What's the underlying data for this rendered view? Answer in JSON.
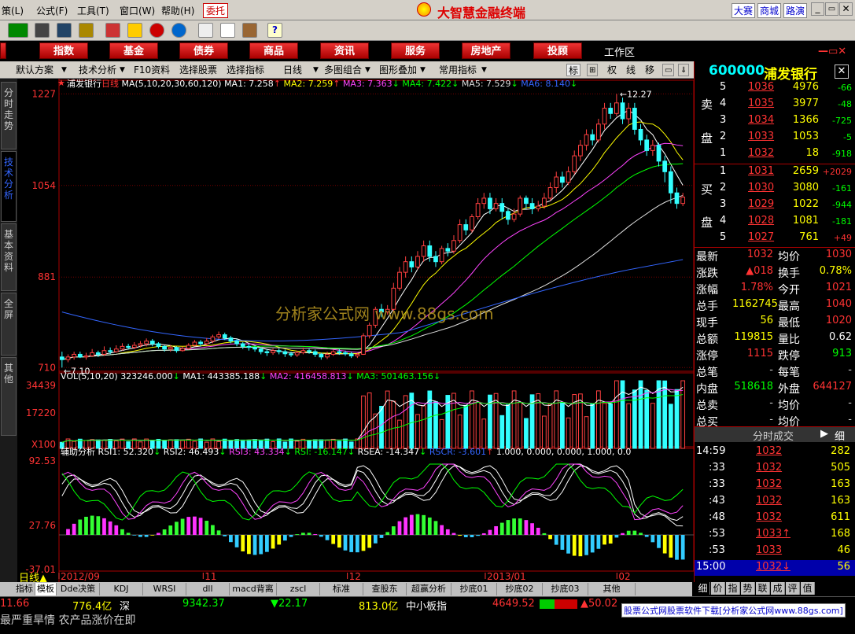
{
  "menu": {
    "items": [
      "策(L)",
      "公式(F)",
      "工具(T)",
      "窗口(W)",
      "帮助(H)"
    ],
    "weituo": "委托",
    "app_title": "大智慧金融终端",
    "links": [
      "大赛",
      "商城",
      "路演"
    ]
  },
  "categories": [
    "",
    "指数",
    "基金",
    "债券",
    "商品",
    "资讯",
    "服务",
    "房地产",
    "投顾"
  ],
  "workspace": "工作区",
  "subtoolbar": {
    "items": [
      "默认方案",
      "技术分析",
      "F10资料",
      "选择股票",
      "选择指标",
      "日线",
      "多图组合",
      "图形叠加",
      "常用指标"
    ],
    "right": [
      "标",
      "",
      "权",
      "线",
      "移"
    ]
  },
  "left_tabs": [
    "分时走势",
    "技术分析",
    "基本资料",
    "全屏",
    "其他"
  ],
  "main_legend": {
    "stock": "浦发银行",
    "period": "日线",
    "ma": "MA(5,10,20,30,60,120)",
    "items": [
      {
        "t": "MA1: 7.258",
        "c": "#ffffff"
      },
      {
        "t": "MA2: 7.259",
        "c": "#ffff00"
      },
      {
        "t": "MA3: 7.363",
        "c": "#ff44ff"
      },
      {
        "t": "MA4: 7.422",
        "c": "#00ff00"
      },
      {
        "t": "MA5: 7.529",
        "c": "#dddddd"
      },
      {
        "t": "MA6: 8.140",
        "c": "#3366ff"
      }
    ],
    "arrows": [
      "↑",
      "↑",
      "↓",
      "↓",
      "↓",
      "↓"
    ]
  },
  "y_main": [
    "1227",
    "1054",
    "881",
    "710"
  ],
  "annot": {
    "high": "12.27",
    "low": "7.10"
  },
  "watermark": "分析家公式网 www.88gs.com",
  "vol_legend": {
    "prefix": "VOL(5,10,20)",
    "items": [
      {
        "t": "323246.000",
        "c": "#ffffff"
      },
      {
        "t": "MA1: 443385.188",
        "c": "#ffffff"
      },
      {
        "t": "MA2: 416458.813",
        "c": "#ff44ff"
      },
      {
        "t": "MA3: 501463.156",
        "c": "#00ff00"
      }
    ],
    "arrows": [
      "↓",
      "↓",
      "↓",
      "↓"
    ]
  },
  "y_vol": [
    "34439",
    "17220",
    "X100"
  ],
  "rsi_legend": {
    "prefix": "辅助分析",
    "items": [
      {
        "t": "RSI1: 52.320",
        "c": "#ffffff"
      },
      {
        "t": "RSI2: 46.493",
        "c": "#ffffff"
      },
      {
        "t": "RSI3: 43.334",
        "c": "#ff44ff"
      },
      {
        "t": "RSI: -16.147",
        "c": "#00ff00"
      },
      {
        "t": "RSEA: -14.347",
        "c": "#ffffff"
      },
      {
        "t": "RSCR: -3.601",
        "c": "#3366ff"
      },
      {
        "t": "1.000, 0.000, 0.000, 1.000, 0.0",
        "c": "#ffffff"
      }
    ],
    "arrows": [
      "↓",
      "↓",
      "↓",
      "↓",
      "↓",
      "↑",
      ""
    ]
  },
  "y_rsi": [
    "92.53",
    "27.76",
    "-37.01"
  ],
  "x_dates": [
    "2012/09",
    "11",
    "12",
    "2013/01",
    "02"
  ],
  "period_label": "日线",
  "bottom_tabs": [
    "指标",
    "模板",
    "Dde决策",
    "KDJ",
    "WRSI",
    "dll",
    "macd背离",
    "zscl",
    "标准",
    "查股东",
    "超赢分析",
    "抄底01",
    "抄底02",
    "抄底03",
    "其他"
  ],
  "quote": {
    "code": "600000",
    "name": "浦发银行",
    "sell": [
      {
        "n": "5",
        "p": "1036",
        "v": "4976",
        "c": "-66"
      },
      {
        "n": "4",
        "p": "1035",
        "v": "3977",
        "c": "-48"
      },
      {
        "n": "3",
        "p": "1034",
        "v": "1366",
        "c": "-725"
      },
      {
        "n": "2",
        "p": "1033",
        "v": "1053",
        "c": "-5"
      },
      {
        "n": "1",
        "p": "1032",
        "v": "18",
        "c": "-918"
      }
    ],
    "buy": [
      {
        "n": "1",
        "p": "1031",
        "v": "2659",
        "c": "+2029"
      },
      {
        "n": "2",
        "p": "1030",
        "v": "3080",
        "c": "-161"
      },
      {
        "n": "3",
        "p": "1029",
        "v": "1022",
        "c": "-944"
      },
      {
        "n": "4",
        "p": "1028",
        "v": "1081",
        "c": "-181"
      },
      {
        "n": "5",
        "p": "1027",
        "v": "761",
        "c": "+49"
      }
    ],
    "sell_label": [
      "卖",
      "盘"
    ],
    "buy_label": [
      "买",
      "盘"
    ],
    "stats": [
      {
        "l1": "最新",
        "v1": "1032",
        "c1": "#ff3333",
        "l2": "均价",
        "v2": "1030",
        "c2": "#ff3333"
      },
      {
        "l1": "涨跌",
        "v1": "▲018",
        "c1": "#ff3333",
        "l2": "换手",
        "v2": "0.78%",
        "c2": "#ffff00"
      },
      {
        "l1": "涨幅",
        "v1": "1.78%",
        "c1": "#ff3333",
        "l2": "今开",
        "v2": "1021",
        "c2": "#ff3333"
      },
      {
        "l1": "总手",
        "v1": "1162745",
        "c1": "#ffff00",
        "l2": "最高",
        "v2": "1040",
        "c2": "#ff3333"
      },
      {
        "l1": "现手",
        "v1": "56",
        "c1": "#ffff00",
        "l2": "最低",
        "v2": "1020",
        "c2": "#ff3333"
      },
      {
        "l1": "总额",
        "v1": "119815",
        "c1": "#ffff00",
        "l2": "量比",
        "v2": "0.62",
        "c2": "#ffffff"
      },
      {
        "l1": "涨停",
        "v1": "1115",
        "c1": "#ff3333",
        "l2": "跌停",
        "v2": "913",
        "c2": "#00ff00"
      },
      {
        "l1": "总笔",
        "v1": "-",
        "c1": "#cccccc",
        "l2": "每笔",
        "v2": "-",
        "c2": "#cccccc"
      },
      {
        "l1": "内盘",
        "v1": "518618",
        "c1": "#00ff00",
        "l2": "外盘",
        "v2": "644127",
        "c2": "#ff3333"
      },
      {
        "l1": "总卖",
        "v1": "-",
        "c1": "#cccccc",
        "l2": "均价",
        "v2": "-",
        "c2": "#cccccc"
      },
      {
        "l1": "总买",
        "v1": "-",
        "c1": "#cccccc",
        "l2": "均价",
        "v2": "-",
        "c2": "#cccccc"
      }
    ],
    "ticks_header": "分时成交",
    "ticks_btn": "细",
    "ticks": [
      {
        "t": "14:59",
        "p": "1032",
        "v": "282"
      },
      {
        "t": ":33",
        "p": "1032",
        "v": "505"
      },
      {
        "t": ":33",
        "p": "1032",
        "v": "163"
      },
      {
        "t": ":43",
        "p": "1032",
        "v": "163"
      },
      {
        "t": ":48",
        "p": "1032",
        "v": "611"
      },
      {
        "t": ":53",
        "p": "1033↑",
        "v": "168"
      },
      {
        "t": ":53",
        "p": "1033",
        "v": "46"
      },
      {
        "t": "15:00",
        "p": "1032↓",
        "v": "56"
      }
    ],
    "rtabs": [
      "细",
      "价",
      "指",
      "势",
      "联",
      "成",
      "评",
      "值"
    ]
  },
  "status": {
    "a": "11.66",
    "b": "776.4亿",
    "c": "深",
    "d": "9342.37",
    "e": "▼22.17",
    "f": "813.0亿",
    "g": "中小板指",
    "h": "4649.52",
    "i": "▲50.02",
    "j": "",
    "k": "股票公式网股票软件下载[分析家公式网www.88gs.com]"
  },
  "ticker": "最严重旱情 农产品涨价在即",
  "chart_data": {
    "type": "candlestick",
    "series": "浦发银行 日线",
    "high": 12.27,
    "low": 7.1,
    "y_ticks": [
      12.27,
      10.54,
      8.81,
      7.1
    ],
    "candles": [
      [
        7.3,
        7.25,
        7.4,
        7.1
      ],
      [
        7.25,
        7.3,
        7.35,
        7.2
      ],
      [
        7.3,
        7.35,
        7.4,
        7.25
      ],
      [
        7.35,
        7.3,
        7.4,
        7.28
      ],
      [
        7.3,
        7.32,
        7.38,
        7.25
      ],
      [
        7.32,
        7.38,
        7.45,
        7.3
      ],
      [
        7.38,
        7.35,
        7.42,
        7.3
      ],
      [
        7.35,
        7.42,
        7.5,
        7.32
      ],
      [
        7.42,
        7.4,
        7.48,
        7.35
      ],
      [
        7.4,
        7.45,
        7.52,
        7.38
      ],
      [
        7.45,
        7.5,
        7.56,
        7.42
      ],
      [
        7.5,
        7.48,
        7.55,
        7.44
      ],
      [
        7.48,
        7.52,
        7.58,
        7.45
      ],
      [
        7.52,
        7.55,
        7.6,
        7.48
      ],
      [
        7.55,
        7.6,
        7.65,
        7.5
      ],
      [
        7.6,
        7.55,
        7.64,
        7.5
      ],
      [
        7.55,
        7.5,
        7.58,
        7.46
      ],
      [
        7.5,
        7.45,
        7.52,
        7.4
      ],
      [
        7.45,
        7.48,
        7.52,
        7.4
      ],
      [
        7.48,
        7.42,
        7.5,
        7.38
      ],
      [
        7.42,
        7.46,
        7.5,
        7.4
      ],
      [
        7.46,
        7.52,
        7.56,
        7.44
      ],
      [
        7.52,
        7.58,
        7.62,
        7.5
      ],
      [
        7.58,
        7.55,
        7.62,
        7.5
      ],
      [
        7.55,
        7.6,
        7.66,
        7.52
      ],
      [
        7.6,
        7.68,
        7.72,
        7.56
      ],
      [
        7.68,
        7.72,
        7.78,
        7.64
      ],
      [
        7.72,
        7.66,
        7.76,
        7.62
      ],
      [
        7.66,
        7.6,
        7.7,
        7.56
      ],
      [
        7.6,
        7.55,
        7.64,
        7.5
      ],
      [
        7.55,
        7.5,
        7.58,
        7.45
      ],
      [
        7.5,
        7.48,
        7.55,
        7.42
      ],
      [
        7.48,
        7.45,
        7.5,
        7.4
      ],
      [
        7.45,
        7.4,
        7.48,
        7.35
      ],
      [
        7.4,
        7.38,
        7.45,
        7.32
      ],
      [
        7.38,
        7.42,
        7.46,
        7.34
      ],
      [
        7.42,
        7.4,
        7.46,
        7.35
      ],
      [
        7.4,
        7.36,
        7.44,
        7.3
      ],
      [
        7.36,
        7.34,
        7.4,
        7.3
      ],
      [
        7.34,
        7.38,
        7.42,
        7.3
      ],
      [
        7.38,
        7.42,
        7.48,
        7.35
      ],
      [
        7.42,
        7.4,
        7.46,
        7.36
      ],
      [
        7.4,
        7.35,
        7.44,
        7.3
      ],
      [
        7.35,
        7.3,
        7.38,
        7.25
      ],
      [
        7.3,
        7.35,
        7.4,
        7.26
      ],
      [
        7.35,
        7.4,
        7.44,
        7.32
      ],
      [
        7.4,
        7.38,
        7.45,
        7.34
      ],
      [
        7.38,
        7.36,
        7.42,
        7.32
      ],
      [
        7.36,
        7.32,
        7.4,
        7.28
      ],
      [
        7.32,
        7.35,
        7.38,
        7.28
      ],
      [
        7.35,
        7.7,
        7.75,
        7.34
      ],
      [
        7.7,
        7.9,
        7.95,
        7.65
      ],
      [
        7.9,
        8.2,
        8.25,
        7.85
      ],
      [
        8.2,
        8.15,
        8.3,
        8.05
      ],
      [
        8.15,
        8.2,
        8.28,
        8.1
      ],
      [
        8.2,
        8.6,
        8.7,
        8.15
      ],
      [
        8.6,
        8.9,
        9.0,
        8.55
      ],
      [
        8.9,
        9.1,
        9.2,
        8.8
      ],
      [
        9.1,
        9.0,
        9.2,
        8.9
      ],
      [
        9.0,
        9.2,
        9.3,
        8.95
      ],
      [
        9.2,
        9.4,
        9.5,
        9.1
      ],
      [
        9.4,
        9.2,
        9.5,
        9.1
      ],
      [
        9.2,
        9.1,
        9.3,
        9.0
      ],
      [
        9.1,
        9.35,
        9.4,
        9.05
      ],
      [
        9.35,
        9.3,
        9.45,
        9.2
      ],
      [
        9.3,
        9.5,
        9.6,
        9.25
      ],
      [
        9.5,
        9.8,
        9.9,
        9.45
      ],
      [
        9.8,
        9.7,
        9.9,
        9.6
      ],
      [
        9.7,
        9.95,
        10.0,
        9.65
      ],
      [
        9.95,
        10.2,
        10.3,
        9.9
      ],
      [
        10.2,
        10.3,
        10.4,
        10.1
      ],
      [
        10.3,
        10.1,
        10.4,
        10.0
      ],
      [
        10.1,
        10.2,
        10.3,
        10.05
      ],
      [
        10.2,
        10.05,
        10.3,
        9.9
      ],
      [
        10.05,
        9.9,
        10.1,
        9.8
      ],
      [
        9.9,
        10.0,
        10.1,
        9.85
      ],
      [
        10.0,
        10.3,
        10.35,
        9.95
      ],
      [
        10.3,
        10.2,
        10.35,
        10.1
      ],
      [
        10.2,
        10.1,
        10.3,
        10.0
      ],
      [
        10.1,
        10.15,
        10.25,
        10.05
      ],
      [
        10.15,
        10.3,
        10.4,
        10.1
      ],
      [
        10.3,
        10.5,
        10.6,
        10.25
      ],
      [
        10.5,
        10.7,
        10.8,
        10.4
      ],
      [
        10.7,
        10.6,
        10.8,
        10.5
      ],
      [
        10.6,
        10.8,
        10.9,
        10.55
      ],
      [
        10.8,
        11.1,
        11.2,
        10.75
      ],
      [
        11.1,
        11.3,
        11.4,
        11.0
      ],
      [
        11.3,
        11.5,
        11.6,
        11.2
      ],
      [
        11.5,
        11.4,
        11.6,
        11.3
      ],
      [
        11.4,
        11.7,
        11.8,
        11.35
      ],
      [
        11.7,
        12.0,
        12.1,
        11.6
      ],
      [
        12.0,
        11.9,
        12.1,
        11.8
      ],
      [
        11.9,
        12.1,
        12.27,
        11.85
      ],
      [
        12.1,
        11.8,
        12.2,
        11.7
      ],
      [
        11.8,
        12.0,
        12.1,
        11.7
      ],
      [
        12.0,
        11.6,
        12.1,
        11.5
      ],
      [
        11.6,
        11.4,
        11.7,
        11.3
      ],
      [
        11.4,
        11.2,
        11.5,
        11.1
      ],
      [
        11.2,
        11.3,
        11.4,
        11.1
      ],
      [
        11.3,
        11.0,
        11.35,
        10.9
      ],
      [
        11.0,
        10.8,
        11.1,
        10.6
      ],
      [
        10.8,
        10.4,
        10.9,
        10.2
      ],
      [
        10.4,
        10.2,
        10.5,
        10.1
      ],
      [
        10.2,
        10.32,
        10.4,
        10.15
      ]
    ]
  }
}
